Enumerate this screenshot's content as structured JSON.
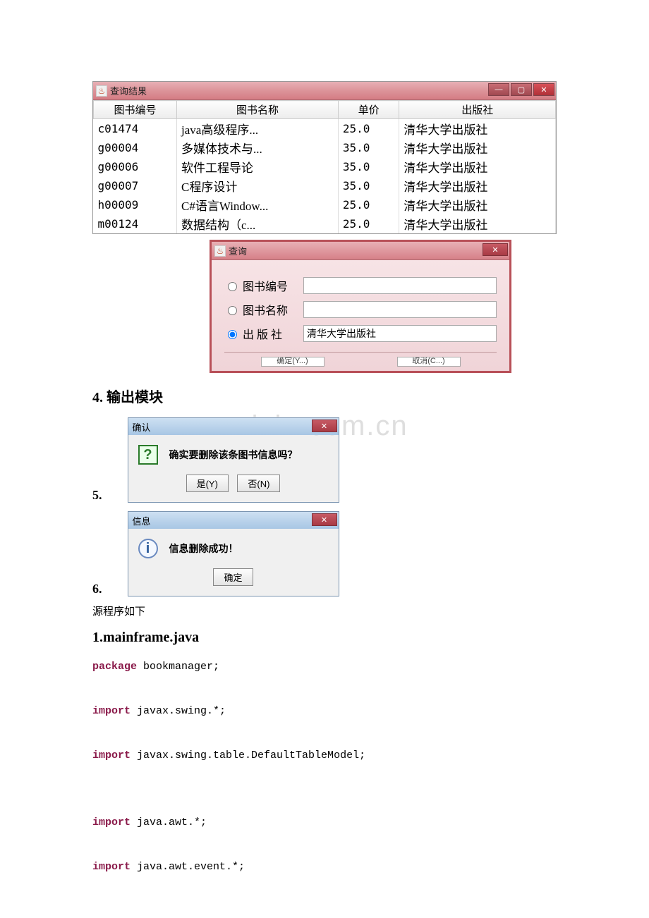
{
  "results_window": {
    "title": "查询结果",
    "columns": [
      "图书编号",
      "图书名称",
      "单价",
      "出版社"
    ],
    "rows": [
      {
        "id": "c01474",
        "name": "java高级程序...",
        "price": "25.0",
        "publisher": "清华大学出版社"
      },
      {
        "id": "g00004",
        "name": "多媒体技术与...",
        "price": "35.0",
        "publisher": "清华大学出版社"
      },
      {
        "id": "g00006",
        "name": "软件工程导论",
        "price": "35.0",
        "publisher": "清华大学出版社"
      },
      {
        "id": "g00007",
        "name": "C程序设计",
        "price": "35.0",
        "publisher": "清华大学出版社"
      },
      {
        "id": "h00009",
        "name": "C#语言Window...",
        "price": "25.0",
        "publisher": "清华大学出版社"
      },
      {
        "id": "m00124",
        "name": "数据结构（c...",
        "price": "25.0",
        "publisher": "清华大学出版社"
      }
    ]
  },
  "query_dialog": {
    "title": "查询",
    "radios": {
      "book_id": "图书编号",
      "book_name": "图书名称",
      "publisher": "出 版 社"
    },
    "publisher_value": "清华大学出版社",
    "ok_partial": "确定(Y...)",
    "cancel_partial": "取消(C...)"
  },
  "section_4": "4. 输出模块",
  "list_5": "5.",
  "list_6": "6.",
  "confirm_box": {
    "title": "确认",
    "message": "确实要删除该条图书信息吗？",
    "yes": "是(Y)",
    "no": "否(N)"
  },
  "info_box": {
    "title": "信息",
    "message": "信息删除成功！",
    "ok": "确定"
  },
  "plain_text": "源程序如下",
  "file_heading": "1.mainframe.java",
  "code": {
    "l1a": "package",
    "l1b": " bookmanager;",
    "l2a": "import",
    "l2b": " javax.swing.*;",
    "l3a": "import",
    "l3b": " javax.swing.table.DefaultTableModel;",
    "l4a": "import",
    "l4b": " java.awt.*;",
    "l5a": "import",
    "l5b": " java.awt.event.*;"
  },
  "watermark": "www.zixin.com.cn"
}
